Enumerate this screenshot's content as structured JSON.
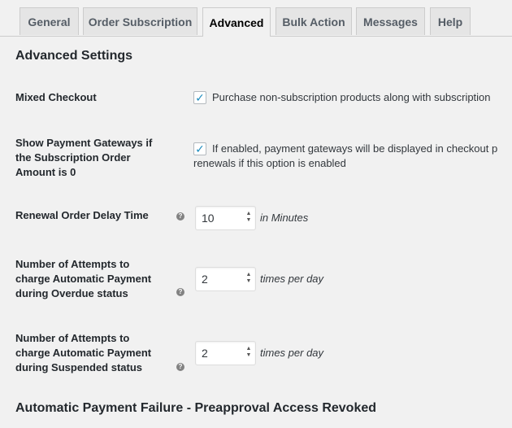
{
  "tabs": [
    {
      "label": "General"
    },
    {
      "label": "Order Subscription"
    },
    {
      "label": "Advanced"
    },
    {
      "label": "Bulk Action"
    },
    {
      "label": "Messages"
    },
    {
      "label": "Help"
    }
  ],
  "active_tab": "Advanced",
  "section_title": "Advanced Settings",
  "settings": {
    "mixed_checkout": {
      "label": "Mixed Checkout",
      "checked": true,
      "description": "Purchase non-subscription products along with subscription"
    },
    "show_gateways": {
      "label_line1": "Show Payment Gateways if",
      "label_line2": "the Subscription Order",
      "label_line3": "Amount is 0",
      "checked": true,
      "description_line1": "If enabled, payment gateways will be displayed in checkout p",
      "description_line2": "renewals if this option is enabled"
    },
    "renewal_delay": {
      "label": "Renewal Order Delay Time",
      "value": "10",
      "unit": "in Minutes"
    },
    "overdue_attempts": {
      "label_line1": "Number of Attempts to",
      "label_line2": "charge Automatic Payment",
      "label_line3": "during Overdue status",
      "value": "2",
      "unit": "times per day"
    },
    "suspended_attempts": {
      "label_line1": "Number of Attempts to",
      "label_line2": "charge Automatic Payment",
      "label_line3": "during Suspended status",
      "value": "2",
      "unit": "times per day"
    }
  },
  "next_section_title": "Automatic Payment Failure - Preapproval Access Revoked",
  "glyphs": {
    "check": "✓",
    "help": "?",
    "spin_up": "▲",
    "spin_down": "▼"
  }
}
